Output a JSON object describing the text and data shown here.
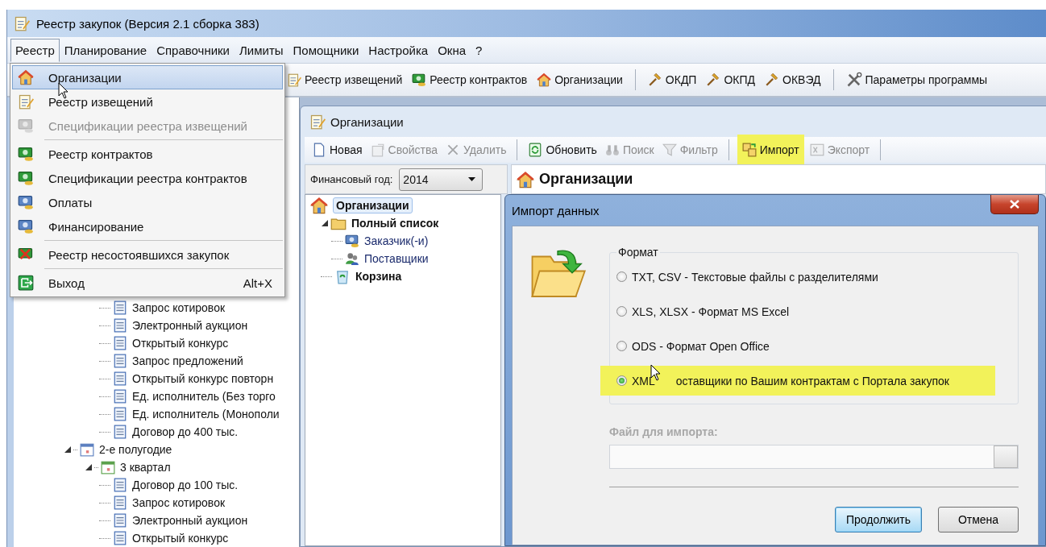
{
  "window": {
    "title": "Реестр закупок (Версия 2.1 сборка 383)"
  },
  "menubar": [
    {
      "label": "Реестр",
      "selected": true
    },
    {
      "label": "Планирование",
      "selected": false
    },
    {
      "label": "Справочники",
      "selected": false
    },
    {
      "label": "Лимиты",
      "selected": false
    },
    {
      "label": "Помощники",
      "selected": false
    },
    {
      "label": "Настройка",
      "selected": false
    },
    {
      "label": "Окна",
      "selected": false
    },
    {
      "label": "?",
      "selected": false
    }
  ],
  "menu": {
    "items": [
      {
        "kind": "item",
        "label": "Организации",
        "highlighted": true,
        "disabled": false
      },
      {
        "kind": "item",
        "label": "Реестр извещений",
        "highlighted": false,
        "disabled": false
      },
      {
        "kind": "item",
        "label": "Спецификации реестра извещений",
        "highlighted": false,
        "disabled": true
      },
      {
        "kind": "separator"
      },
      {
        "kind": "item",
        "label": "Реестр контрактов",
        "highlighted": false,
        "disabled": false
      },
      {
        "kind": "item",
        "label": "Спецификации реестра контрактов",
        "highlighted": false,
        "disabled": false
      },
      {
        "kind": "item",
        "label": "Оплаты",
        "highlighted": false,
        "disabled": false
      },
      {
        "kind": "item",
        "label": "Финансирование",
        "highlighted": false,
        "disabled": false
      },
      {
        "kind": "separator"
      },
      {
        "kind": "item",
        "label": "Реестр несостоявшихся закупок",
        "highlighted": false,
        "disabled": false
      },
      {
        "kind": "separator"
      },
      {
        "kind": "item",
        "label": "Выход",
        "shortcut": "Alt+X",
        "highlighted": false,
        "disabled": false
      }
    ]
  },
  "toolbar": [
    {
      "kind": "button",
      "label": "Реестр извещений"
    },
    {
      "kind": "button",
      "label": "Реестр контрактов"
    },
    {
      "kind": "button",
      "label": "Организации"
    },
    {
      "kind": "separator"
    },
    {
      "kind": "button",
      "label": "ОКДП"
    },
    {
      "kind": "button",
      "label": "ОКПД"
    },
    {
      "kind": "button",
      "label": "ОКВЭД"
    },
    {
      "kind": "separator"
    },
    {
      "kind": "button",
      "label": "Параметры программы"
    }
  ],
  "register_tree": {
    "partial_items": [
      {
        "label": "Запрос котировок"
      },
      {
        "label": "Электронный аукцион"
      },
      {
        "label": "Открытый конкурс"
      },
      {
        "label": "Запрос предложений"
      },
      {
        "label": "Открытый конкурс повторн"
      },
      {
        "label": "Ед. исполнитель (Без торго"
      },
      {
        "label": "Ед. исполнитель (Монополи"
      },
      {
        "label": "Договор до 400 тыс."
      }
    ],
    "nodes": [
      {
        "label": "2-е полугодие",
        "expanded": true,
        "children": [
          {
            "label": "3 квартал",
            "expanded": true,
            "children": [
              {
                "label": "Договор до 100 тыс."
              },
              {
                "label": "Запрос котировок"
              },
              {
                "label": "Электронный аукцион"
              },
              {
                "label": "Открытый конкурс"
              }
            ]
          }
        ]
      }
    ]
  },
  "child_window": {
    "title": "Организации",
    "toolbar": [
      {
        "kind": "button",
        "label": "Новая",
        "disabled": false,
        "highlighted": false
      },
      {
        "kind": "button",
        "label": "Свойства",
        "disabled": true,
        "highlighted": false
      },
      {
        "kind": "button",
        "label": "Удалить",
        "disabled": true,
        "highlighted": false
      },
      {
        "kind": "separator"
      },
      {
        "kind": "button",
        "label": "Обновить",
        "disabled": false,
        "highlighted": false
      },
      {
        "kind": "button",
        "label": "Поиск",
        "disabled": true,
        "highlighted": false
      },
      {
        "kind": "button",
        "label": "Фильтр",
        "disabled": true,
        "highlighted": false
      },
      {
        "kind": "separator"
      },
      {
        "kind": "button",
        "label": "Импорт",
        "disabled": false,
        "highlighted": true
      },
      {
        "kind": "button",
        "label": "Экспорт",
        "disabled": true,
        "highlighted": false
      },
      {
        "kind": "separator"
      }
    ],
    "year_filter": {
      "label": "Финансовый год:",
      "value": "2014"
    },
    "header": "Организации",
    "tree": [
      {
        "label": "Организации",
        "kind": "folder",
        "selected": true,
        "children": [
          {
            "label": "Полный список",
            "kind": "folder",
            "selected": false,
            "expanded": true,
            "children": [
              {
                "label": "Заказчик(-и)",
                "kind": "item",
                "selected": false
              },
              {
                "label": "Поставщики",
                "kind": "item",
                "selected": false
              }
            ]
          },
          {
            "label": "Корзина",
            "kind": "folder",
            "selected": false
          }
        ]
      }
    ]
  },
  "dialog": {
    "title": "Импорт данных",
    "format": {
      "legend": "Формат",
      "options": [
        {
          "label": "TXT, CSV -  Текстовые файлы с разделителями",
          "selected": false,
          "highlighted": false
        },
        {
          "label": "XLS, XLSX - Формат MS Excel",
          "selected": false,
          "highlighted": false
        },
        {
          "label": "ODS - Формат Open Office",
          "selected": false,
          "highlighted": false
        },
        {
          "label": "XML",
          "label_rest": "оставщики по Вашим контрактам с Портала закупок",
          "selected": true,
          "highlighted": true
        }
      ]
    },
    "file": {
      "label": "Файл для импорта:",
      "disabled": true
    },
    "buttons": [
      {
        "label": "Продолжить",
        "default": true
      },
      {
        "label": "Отмена",
        "default": false
      }
    ]
  }
}
